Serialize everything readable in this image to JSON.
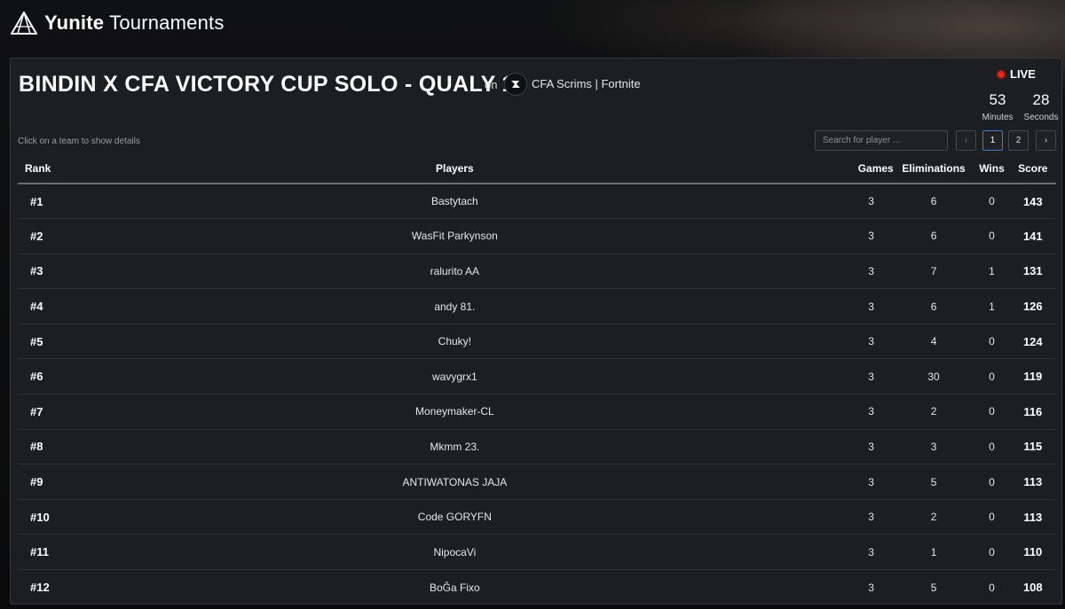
{
  "brand": {
    "name_bold": "Yunite",
    "name_rest": "Tournaments"
  },
  "tournament": {
    "title": "BINDIN X CFA VICTORY CUP SOLO - QUALY 1",
    "on_label": "on",
    "org_name": "CFA Scrims | Fortnite"
  },
  "live": {
    "label": "LIVE",
    "minutes": "53",
    "minutes_label": "Minutes",
    "seconds": "28",
    "seconds_label": "Seconds",
    "color": "#e8231f"
  },
  "hint": "Click on a team to show details",
  "search": {
    "placeholder": "Search for player ..."
  },
  "pagination": {
    "prev": "‹",
    "pages": [
      "1",
      "2"
    ],
    "current": "1",
    "next": "›"
  },
  "table": {
    "headers": {
      "rank": "Rank",
      "players": "Players",
      "games": "Games",
      "eliminations": "Eliminations",
      "wins": "Wins",
      "score": "Score"
    },
    "rows": [
      {
        "rank": "#1",
        "player": "Bastytach",
        "games": "3",
        "elims": "6",
        "wins": "0",
        "score": "143"
      },
      {
        "rank": "#2",
        "player": "WasFit Parkynson",
        "games": "3",
        "elims": "6",
        "wins": "0",
        "score": "141"
      },
      {
        "rank": "#3",
        "player": "ralurito AA",
        "games": "3",
        "elims": "7",
        "wins": "1",
        "score": "131"
      },
      {
        "rank": "#4",
        "player": "andy 81.",
        "games": "3",
        "elims": "6",
        "wins": "1",
        "score": "126"
      },
      {
        "rank": "#5",
        "player": "Chuky!",
        "games": "3",
        "elims": "4",
        "wins": "0",
        "score": "124"
      },
      {
        "rank": "#6",
        "player": "wavygrx1",
        "games": "3",
        "elims": "30",
        "wins": "0",
        "score": "119"
      },
      {
        "rank": "#7",
        "player": "Moneymaker-CL",
        "games": "3",
        "elims": "2",
        "wins": "0",
        "score": "116"
      },
      {
        "rank": "#8",
        "player": "Mkmm 23.",
        "games": "3",
        "elims": "3",
        "wins": "0",
        "score": "115"
      },
      {
        "rank": "#9",
        "player": "ANTIWATONAS JAJA",
        "games": "3",
        "elims": "5",
        "wins": "0",
        "score": "113"
      },
      {
        "rank": "#10",
        "player": "Code GORYFN",
        "games": "3",
        "elims": "2",
        "wins": "0",
        "score": "113"
      },
      {
        "rank": "#11",
        "player": "NipocaVi",
        "games": "3",
        "elims": "1",
        "wins": "0",
        "score": "110"
      },
      {
        "rank": "#12",
        "player": "BoĜa Fixo",
        "games": "3",
        "elims": "5",
        "wins": "0",
        "score": "108"
      }
    ]
  }
}
